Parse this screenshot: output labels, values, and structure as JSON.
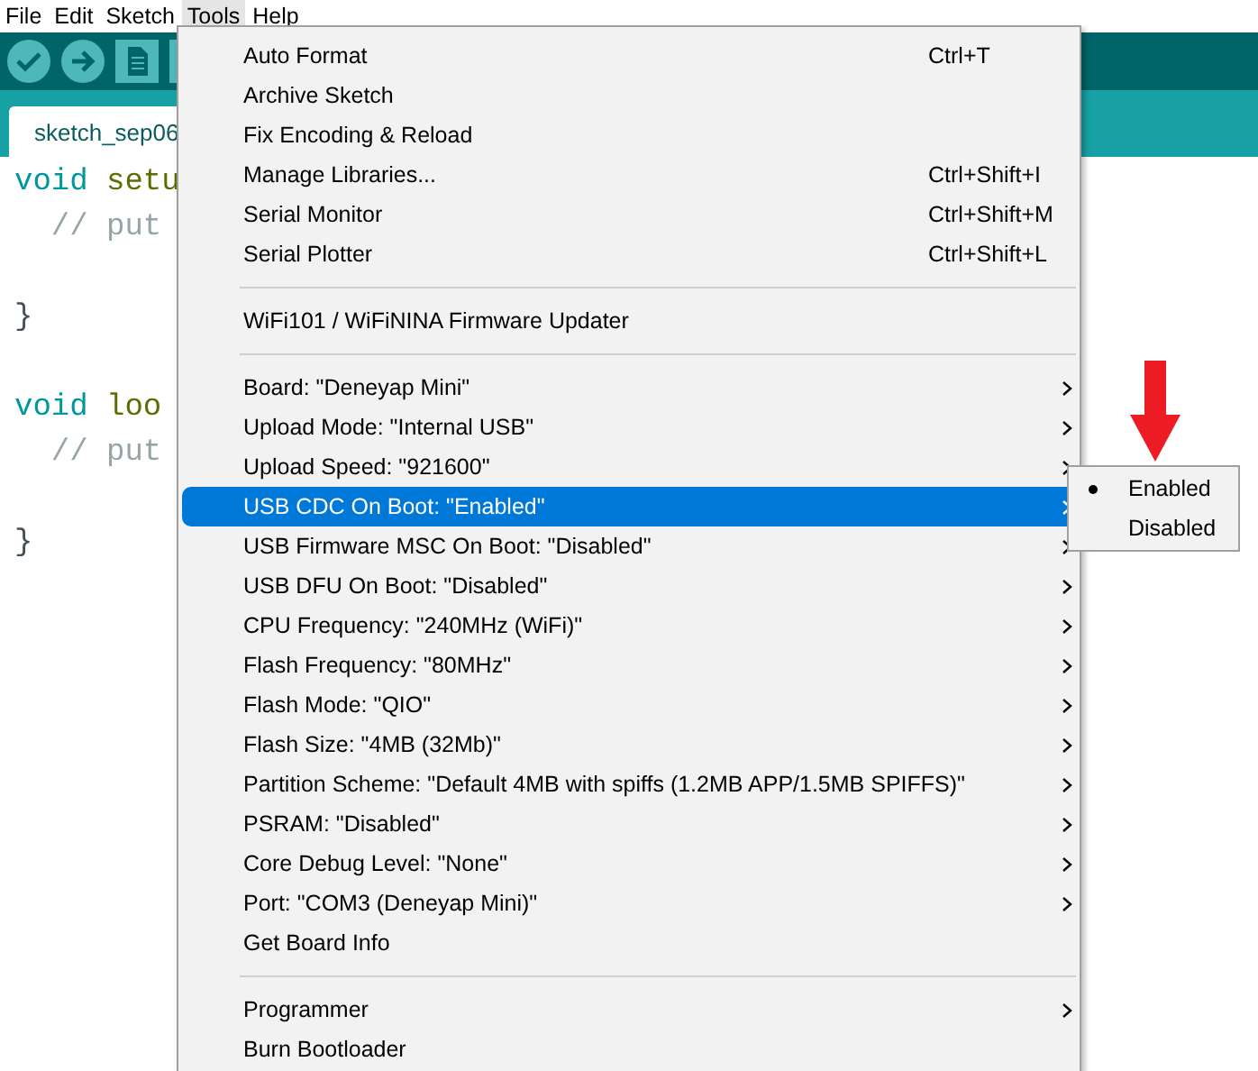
{
  "menubar": [
    {
      "label": "File",
      "selected": false
    },
    {
      "label": "Edit",
      "selected": false
    },
    {
      "label": "Sketch",
      "selected": false
    },
    {
      "label": "Tools",
      "selected": true
    },
    {
      "label": "Help",
      "selected": false
    }
  ],
  "tab": {
    "label": "sketch_sep06"
  },
  "code_lines": [
    {
      "kind": "code",
      "tokens": [
        {
          "text": "void",
          "kind": "keyword"
        },
        {
          "text": "setu",
          "kind": "function"
        }
      ]
    },
    {
      "kind": "code",
      "tokens": [
        {
          "text": "  // put",
          "kind": "comment"
        }
      ]
    },
    {
      "kind": "blank"
    },
    {
      "kind": "code",
      "tokens": [
        {
          "text": "}"
        }
      ]
    },
    {
      "kind": "blank"
    },
    {
      "kind": "code",
      "tokens": [
        {
          "text": "void",
          "kind": "keyword"
        },
        {
          "text": "loo",
          "kind": "function"
        }
      ]
    },
    {
      "kind": "code",
      "tokens": [
        {
          "text": "  // put",
          "kind": "comment"
        }
      ]
    },
    {
      "kind": "blank"
    },
    {
      "kind": "code",
      "tokens": [
        {
          "text": "}"
        }
      ]
    }
  ],
  "tools_menu": {
    "groups": [
      [
        {
          "label": "Auto Format",
          "shortcut": "Ctrl+T",
          "submenu": false,
          "selected": false
        },
        {
          "label": "Archive Sketch",
          "submenu": false,
          "selected": false
        },
        {
          "label": "Fix Encoding & Reload",
          "submenu": false,
          "selected": false
        },
        {
          "label": "Manage Libraries...",
          "shortcut": "Ctrl+Shift+I",
          "submenu": false,
          "selected": false
        },
        {
          "label": "Serial Monitor",
          "shortcut": "Ctrl+Shift+M",
          "submenu": false,
          "selected": false
        },
        {
          "label": "Serial Plotter",
          "shortcut": "Ctrl+Shift+L",
          "submenu": false,
          "selected": false
        }
      ],
      [
        {
          "label": "WiFi101 / WiFiNINA Firmware Updater",
          "submenu": false,
          "selected": false
        }
      ],
      [
        {
          "label": "Board: \"Deneyap Mini\"",
          "submenu": true,
          "selected": false
        },
        {
          "label": "Upload Mode: \"Internal USB\"",
          "submenu": true,
          "selected": false
        },
        {
          "label": "Upload Speed: \"921600\"",
          "submenu": true,
          "selected": false
        },
        {
          "label": "USB CDC On Boot: \"Enabled\"",
          "submenu": true,
          "selected": true
        },
        {
          "label": "USB Firmware MSC On Boot: \"Disabled\"",
          "submenu": true,
          "selected": false
        },
        {
          "label": "USB DFU On Boot: \"Disabled\"",
          "submenu": true,
          "selected": false
        },
        {
          "label": "CPU Frequency: \"240MHz (WiFi)\"",
          "submenu": true,
          "selected": false
        },
        {
          "label": "Flash Frequency: \"80MHz\"",
          "submenu": true,
          "selected": false
        },
        {
          "label": "Flash Mode: \"QIO\"",
          "submenu": true,
          "selected": false
        },
        {
          "label": "Flash Size: \"4MB (32Mb)\"",
          "submenu": true,
          "selected": false
        },
        {
          "label": "Partition Scheme: \"Default 4MB with spiffs (1.2MB APP/1.5MB SPIFFS)\"",
          "submenu": true,
          "selected": false
        },
        {
          "label": "PSRAM: \"Disabled\"",
          "submenu": true,
          "selected": false
        },
        {
          "label": "Core Debug Level: \"None\"",
          "submenu": true,
          "selected": false
        },
        {
          "label": "Port: \"COM3 (Deneyap Mini)\"",
          "submenu": true,
          "selected": false
        },
        {
          "label": "Get Board Info",
          "submenu": false,
          "selected": false
        }
      ],
      [
        {
          "label": "Programmer",
          "submenu": true,
          "selected": false
        },
        {
          "label": "Burn Bootloader",
          "submenu": false,
          "selected": false
        }
      ]
    ]
  },
  "submenu": [
    {
      "label": "Enabled",
      "selected": true
    },
    {
      "label": "Disabled",
      "selected": false
    }
  ]
}
